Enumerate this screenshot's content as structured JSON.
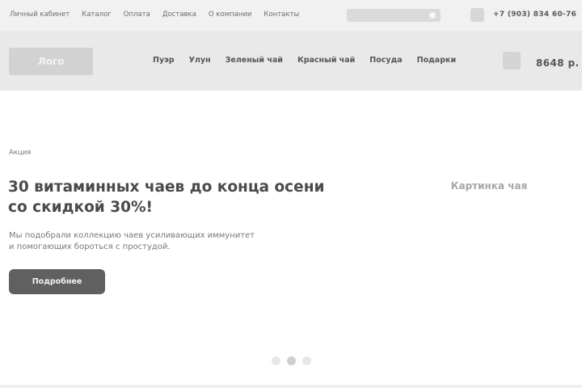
{
  "topbar": {
    "nav": [
      "Личный кабинет",
      "Каталог",
      "Оплата",
      "Доставка",
      "О компании",
      "Контакты"
    ],
    "search_placeholder": "",
    "phone": "+7 (903) 834 60-76"
  },
  "header": {
    "logo": "Лого",
    "nav": [
      "Пуэр",
      "Улун",
      "Зеленый чай",
      "Красный чай",
      "Посуда",
      "Подарки"
    ],
    "cart_total": "8648 р."
  },
  "hero": {
    "tag": "Акция",
    "title_line1": "30 витаминных чаев до конца осени",
    "title_line2": "со скидкой 30%!",
    "desc_line1": "Мы подобрали коллекцию чаев усиливающих иммунитет",
    "desc_line2": "и помогающих бороться с простудой.",
    "button": "Подробнее",
    "image_label": "Картинка чая"
  },
  "slider": {
    "count": 3,
    "active": 2
  }
}
